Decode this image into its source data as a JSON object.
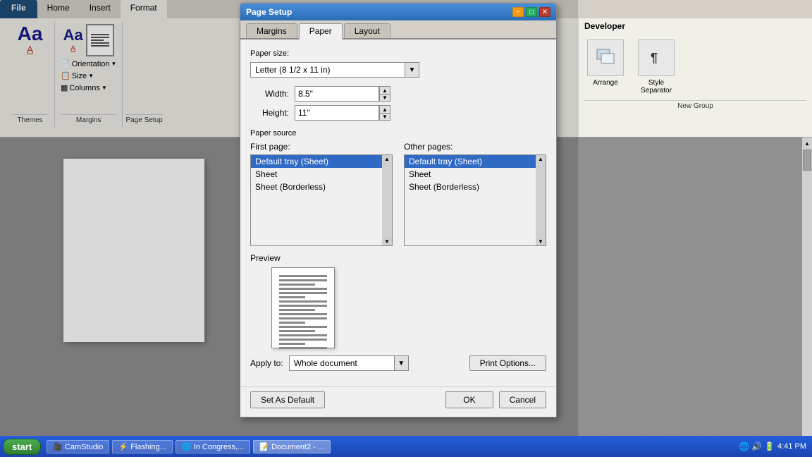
{
  "ribbon": {
    "file_tab": "File",
    "home_tab": "Home",
    "insert_tab": "Insert",
    "format_tab": "Format",
    "themes_label": "Themes",
    "margins_label": "Margins",
    "page_setup_label": "Page Setup",
    "orientation_label": "Orientation",
    "size_label": "Size",
    "columns_label": "Columns"
  },
  "right_panel": {
    "title": "Developer",
    "arrange_label": "Arrange",
    "style_separator_label": "Style Separator",
    "new_group_label": "New Group"
  },
  "dialog": {
    "title": "Page Setup",
    "tabs": [
      "Margins",
      "Paper",
      "Layout"
    ],
    "active_tab": "Paper",
    "paper_size_label": "Paper size:",
    "paper_size_value": "Letter (8 1/2 x 11 in)",
    "width_label": "Width:",
    "width_value": "8.5\"",
    "height_label": "Height:",
    "height_value": "11\"",
    "paper_source_label": "Paper source",
    "first_page_label": "First page:",
    "other_pages_label": "Other pages:",
    "source_items": [
      "Default tray (Sheet)",
      "Sheet",
      "Sheet (Borderless)"
    ],
    "first_page_selected": "Default tray (Sheet)",
    "other_pages_selected": "Default tray (Sheet)",
    "preview_label": "Preview",
    "apply_to_label": "Apply to:",
    "apply_to_value": "Whole document",
    "print_options_btn": "Print Options...",
    "set_default_btn": "Set As Default",
    "ok_btn": "OK",
    "cancel_btn": "Cancel"
  },
  "taskbar": {
    "start_label": "start",
    "items": [
      "CamStudio",
      "Flashing...",
      "In Congress,...",
      "Document2 - ..."
    ],
    "time": "4:41 PM"
  }
}
